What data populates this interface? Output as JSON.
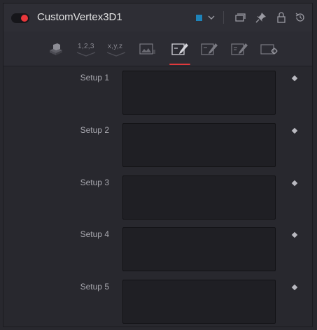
{
  "header": {
    "title": "CustomVertex3D1",
    "swatch_color": "#1e83b9",
    "active_toggle_color": "#e8373b",
    "icons": [
      "color-dropdown-chevron-icon",
      "versions-icon",
      "pin-icon",
      "lock-icon",
      "reset-icon"
    ]
  },
  "tabs": {
    "items": [
      {
        "name": "controls-tab-icon",
        "label": ""
      },
      {
        "name": "numbers-tab",
        "label": "1,2,3"
      },
      {
        "name": "xyz-tab",
        "label": "x,y,z"
      },
      {
        "name": "image-tab-icon",
        "label": ""
      },
      {
        "name": "setup-tab-icon",
        "label": ""
      },
      {
        "name": "intermediate-tab-icon",
        "label": ""
      },
      {
        "name": "expressions-tab-icon",
        "label": ""
      },
      {
        "name": "settings-tab-icon",
        "label": ""
      }
    ],
    "active_index": 4,
    "indicator_color": "#e0393c"
  },
  "setups": [
    {
      "label": "Setup 1",
      "value": ""
    },
    {
      "label": "Setup 2",
      "value": ""
    },
    {
      "label": "Setup 3",
      "value": ""
    },
    {
      "label": "Setup 4",
      "value": ""
    },
    {
      "label": "Setup 5",
      "value": ""
    }
  ]
}
